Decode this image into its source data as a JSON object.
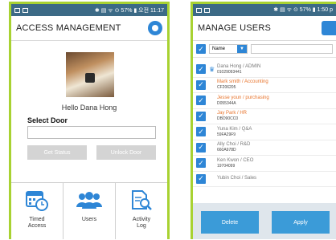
{
  "left": {
    "status": {
      "right": "✱ ▤ ᯤ ⊙ 57% ▮ 오전 11:17"
    },
    "header": {
      "title": "ACCESS MANAGEMENT"
    },
    "greeting": "Hello  Dana Hong",
    "select_door": {
      "label": "Select Door",
      "value": ""
    },
    "buttons": {
      "get_status": "Get Status",
      "unlock_door": "Unlock Door"
    },
    "nav": [
      {
        "label": "Timed\nAccess",
        "icon": "calendar-clock-icon"
      },
      {
        "label": "Users",
        "icon": "users-icon"
      },
      {
        "label": "Activity\nLog",
        "icon": "log-search-icon"
      }
    ]
  },
  "right": {
    "status": {
      "right": "✱ ▤ ᯤ ⊙ 57% ▮ 1:50 p"
    },
    "header": {
      "title": "MANAGE USERS"
    },
    "filter": {
      "select_value": "Name",
      "search_value": ""
    },
    "users": [
      {
        "name": "Dana Hong / ADMIN",
        "code": "01029093441",
        "color": "#777777",
        "admin": true
      },
      {
        "name": "Mark smith / Accounting",
        "code": "CF206205",
        "color": "#e8742c",
        "admin": false
      },
      {
        "name": "Jesse youn / purchasing",
        "code": "D055344A",
        "color": "#e8742c",
        "admin": false
      },
      {
        "name": "Jay Park   / HR",
        "code": "DBD90CC0",
        "color": "#e8742c",
        "admin": false
      },
      {
        "name": "Yuna Kim  / Q&A",
        "code": "59FA29F9",
        "color": "#777777",
        "admin": false
      },
      {
        "name": "Ally Choi  / R&D",
        "code": "660A978D",
        "color": "#777777",
        "admin": false
      },
      {
        "name": "Ken Kwon  / CEO",
        "code": "19704099",
        "color": "#777777",
        "admin": false
      },
      {
        "name": "Yubin Choi / Sales",
        "code": "",
        "color": "#777777",
        "admin": false
      }
    ],
    "actions": {
      "delete": "Delete",
      "apply": "Apply"
    }
  },
  "colors": {
    "accent": "#2e86d6",
    "frame": "#a8d232",
    "statusbar": "#3c6a86",
    "highlight": "#e8742c"
  }
}
